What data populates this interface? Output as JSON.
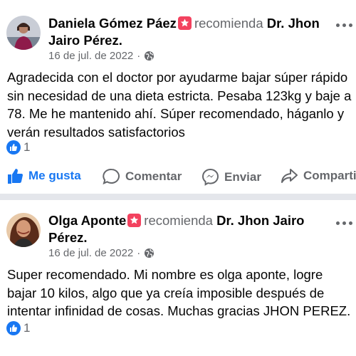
{
  "posts": [
    {
      "author": "Daniela Gómez Páez",
      "recommends_text": "recomienda",
      "page_name_line1": "Dr. Jhon",
      "page_name_line2": "Jairo Pérez",
      "date": "16 de jul. de 2022",
      "audience_icon": "globe-icon",
      "body_lines": [
        "Agradecida con el doctor por ayudarme bajar súper rápido",
        "sin necesidad de una dieta estricta. Pesaba 123kg y baje a",
        "78. Me he mantenido ahí. Súper recomendado, háganlo y",
        "verán resultados satisfactorios"
      ],
      "reaction_count": "1",
      "actions": {
        "like": "Me gusta",
        "comment": "Comentar",
        "send": "Enviar",
        "share": "Compartir"
      }
    },
    {
      "author": "Olga Aponte",
      "recommends_text": "recomienda",
      "page_name_line1": "Dr. Jhon Jairo",
      "page_name_line2": "Pérez",
      "date": "16 de jul. de 2022",
      "audience_icon": "globe-icon",
      "body_lines": [
        "Super recomendado. Mi nombre es olga aponte, logre",
        "bajar 10 kilos, algo que ya creía imposible después de",
        "intentar infinidad de cosas. Muchas gracias JHON PEREZ."
      ],
      "reaction_count": "1"
    }
  ],
  "colors": {
    "like_blue": "#1877f2",
    "recommend_badge": "#f3425f",
    "secondary_text": "#65676b",
    "divider": "#e4e6eb"
  }
}
